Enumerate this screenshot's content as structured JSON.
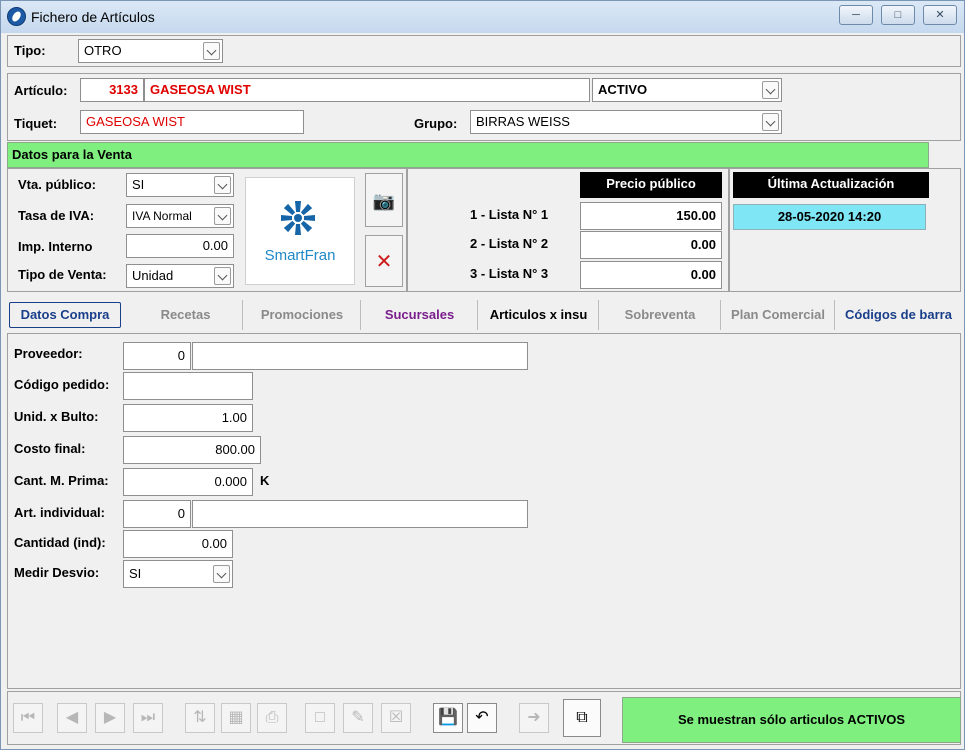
{
  "window": {
    "title": "Fichero de Artículos"
  },
  "tipo": {
    "label": "Tipo:",
    "value": "OTRO"
  },
  "articulo": {
    "label": "Artículo:",
    "code": "3133",
    "name": "GASEOSA WIST",
    "estado": "ACTIVO",
    "tiquet_label": "Tiquet:",
    "tiquet": "GASEOSA WIST",
    "grupo_label": "Grupo:",
    "grupo": "BIRRAS WEISS"
  },
  "venta": {
    "header": "Datos para la Venta",
    "vta_publico_label": "Vta. público:",
    "vta_publico": "SI",
    "tasa_iva_label": "Tasa de IVA:",
    "tasa_iva": "IVA Normal",
    "imp_interno_label": "Imp. Interno",
    "imp_interno": "0.00",
    "tipo_venta_label": "Tipo de Venta:",
    "tipo_venta": "Unidad",
    "logo_text": "SmartFran",
    "precio_header": "Precio público",
    "ultima_header": "Última Actualización",
    "ultima_value": "28-05-2020 14:20",
    "listas": [
      {
        "label": "1 - Lista N° 1",
        "value": "150.00"
      },
      {
        "label": "2 - Lista N° 2",
        "value": "0.00"
      },
      {
        "label": "3 - Lista N° 3",
        "value": "0.00"
      }
    ]
  },
  "tabs": [
    {
      "label": "Datos Compra"
    },
    {
      "label": "Recetas"
    },
    {
      "label": "Promociones"
    },
    {
      "label": "Sucursales"
    },
    {
      "label": "Articulos x insu"
    },
    {
      "label": "Sobreventa"
    },
    {
      "label": "Plan Comercial"
    },
    {
      "label": "Códigos de barra"
    }
  ],
  "compra": {
    "proveedor_label": "Proveedor:",
    "proveedor_code": "0",
    "proveedor_name": "",
    "codigo_pedido_label": "Código pedido:",
    "codigo_pedido": "",
    "unid_bulto_label": "Unid. x Bulto:",
    "unid_bulto": "1.00",
    "costo_final_label": "Costo final:",
    "costo_final": "800.00",
    "cant_mprima_label": "Cant. M. Prima:",
    "cant_mprima": "0.000",
    "cant_mprima_unit": "K",
    "art_individual_label": "Art. individual:",
    "art_individual_code": "0",
    "art_individual_name": "",
    "cantidad_ind_label": "Cantidad (ind):",
    "cantidad_ind": "0.00",
    "medir_desvio_label": "Medir Desvio:",
    "medir_desvio": "SI"
  },
  "status_message": "Se muestran sólo articulos ACTIVOS",
  "colors": {
    "green": "#7ff07f",
    "cyan": "#7fe6f5",
    "red": "#e00000",
    "purple": "#7a1e8c",
    "blue": "#1a3f8a"
  },
  "toolbar_icons": [
    "first-icon",
    "prev-icon",
    "next-icon",
    "last-icon",
    "sort-icon",
    "search-icon",
    "print-icon",
    "new-icon",
    "edit-icon",
    "delete-icon",
    "save-icon",
    "undo-icon",
    "exit-icon",
    "copy-icon"
  ]
}
